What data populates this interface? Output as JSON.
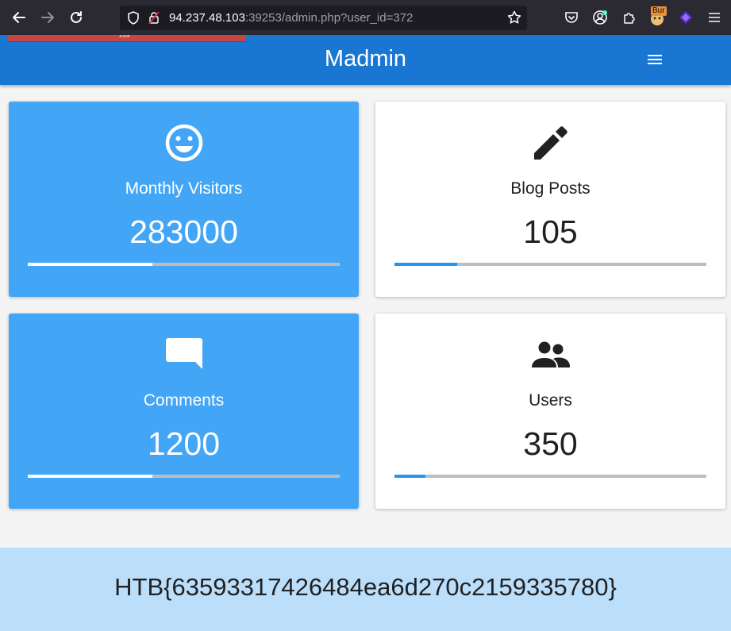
{
  "browser": {
    "url_host": "94.237.48.103",
    "url_rest": ":39253/admin.php?user_id=372",
    "burp_label": "Bur"
  },
  "xss_banner": {
    "text": "xss"
  },
  "app": {
    "title": "Madmin"
  },
  "cards": [
    {
      "label": "Monthly Visitors",
      "value": "283000",
      "icon": "smiley-icon",
      "progress": 0.4,
      "style": "blue"
    },
    {
      "label": "Blog Posts",
      "value": "105",
      "icon": "pencil-icon",
      "progress": 0.2,
      "style": "white"
    },
    {
      "label": "Comments",
      "value": "1200",
      "icon": "comment-icon",
      "progress": 0.4,
      "style": "blue"
    },
    {
      "label": "Users",
      "value": "350",
      "icon": "users-icon",
      "progress": 0.1,
      "style": "white"
    }
  ],
  "flag": {
    "text": "HTB{63593317426484ea6d270c2159335780}"
  },
  "colors": {
    "appbar": "#1976d2",
    "card_blue": "#42a5f5",
    "progress_accent": "#2196f3",
    "flag_bg": "#bbdefb",
    "browser_chrome": "#2b2a33"
  }
}
